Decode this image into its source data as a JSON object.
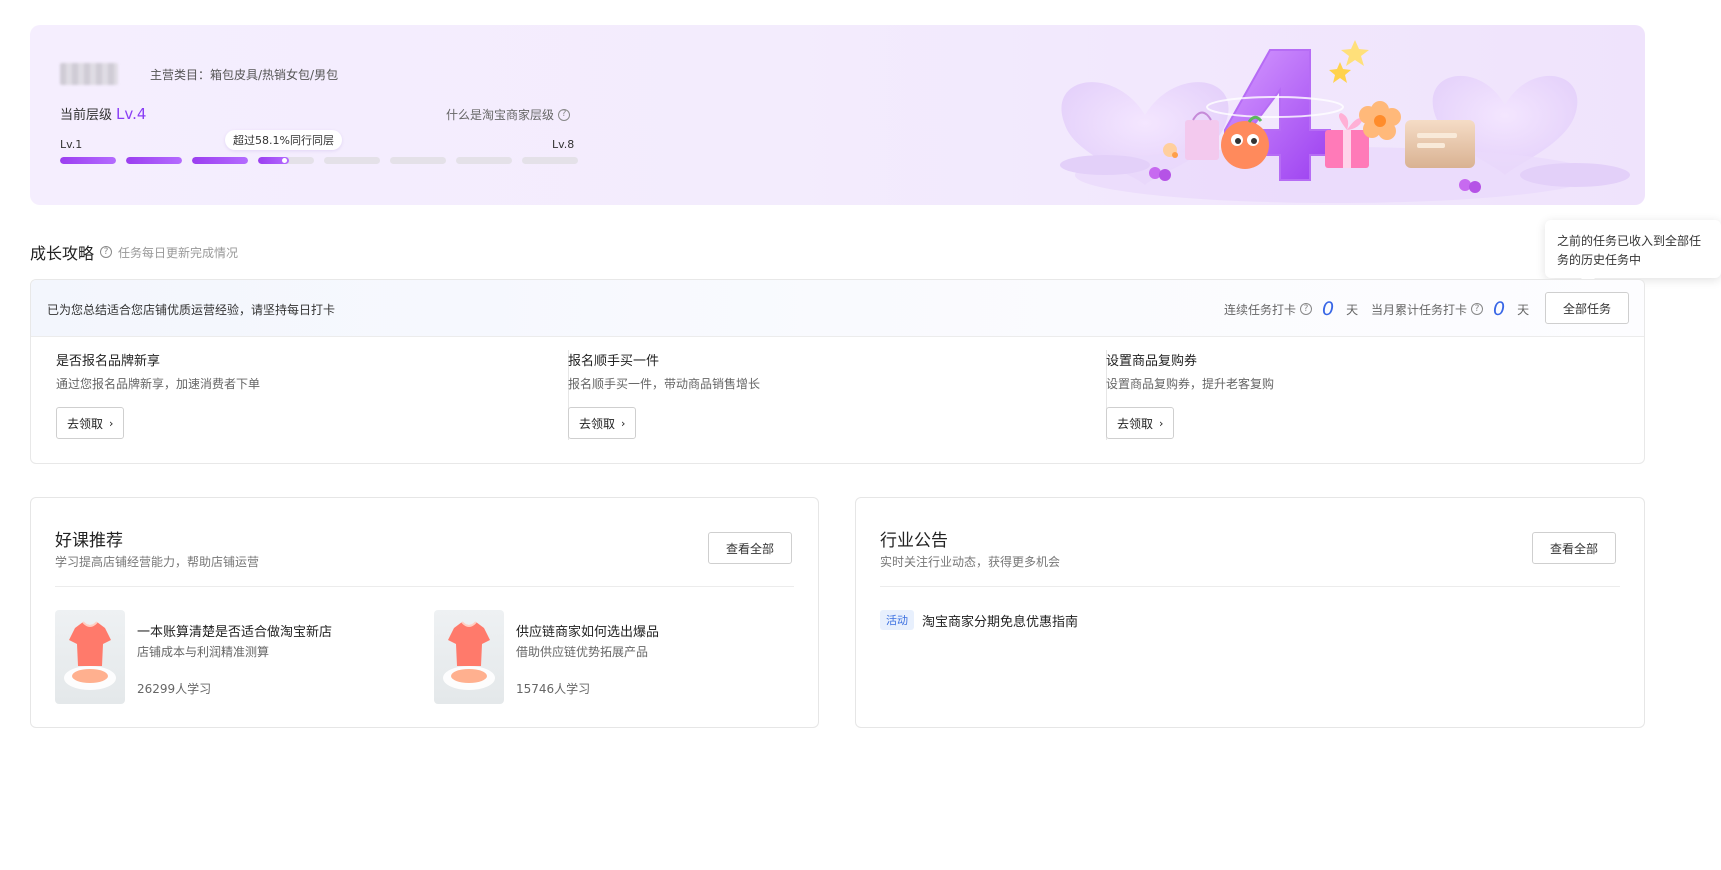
{
  "level": {
    "category": "主营类目：箱包皮具/热销女包/男包",
    "current_label": "当前层级",
    "current_value": "Lv.4",
    "what_is": "什么是淘宝商家层级",
    "min_label": "Lv.1",
    "max_label": "Lv.8",
    "progress_tip": "超过58.1%同行同层",
    "total_levels": 8,
    "current_level": 4,
    "current_segment_fill": 0.55,
    "accent_color": "#8a3ff5"
  },
  "growth": {
    "title": "成长攻略",
    "subtitle": "任务每日更新完成情况",
    "tooltip": "之前的任务已收入到全部任务的历史任务中",
    "header_message": "已为您总结适合您店铺优质运营经验，请坚持每日打卡",
    "streak_label": "连续任务打卡",
    "streak_value": "0",
    "month_label": "当月累计任务打卡",
    "month_value": "0",
    "day_unit": "天",
    "all_tasks_label": "全部任务",
    "tasks": [
      {
        "name": "是否报名品牌新享",
        "desc": "通过您报名品牌新享，加速消费者下单",
        "button": "去领取"
      },
      {
        "name": "报名顺手买一件",
        "desc": "报名顺手买一件，带动商品销售增长",
        "button": "去领取"
      },
      {
        "name": "设置商品复购券",
        "desc": "设置商品复购券，提升老客复购",
        "button": "去领取"
      }
    ]
  },
  "courses": {
    "title": "好课推荐",
    "subtitle": "学习提高店铺经营能力，帮助店铺运营",
    "view_all": "查看全部",
    "items": [
      {
        "name": "一本账算清楚是否适合做淘宝新店",
        "desc": "店铺成本与利润精准测算",
        "count": "26299人学习"
      },
      {
        "name": "供应链商家如何选出爆品",
        "desc": "借助供应链优势拓展产品",
        "count": "15746人学习"
      }
    ]
  },
  "announcements": {
    "title": "行业公告",
    "subtitle": "实时关注行业动态，获得更多机会",
    "view_all": "查看全部",
    "items": [
      {
        "tag": "活动",
        "text": "淘宝商家分期免息优惠指南"
      }
    ]
  }
}
